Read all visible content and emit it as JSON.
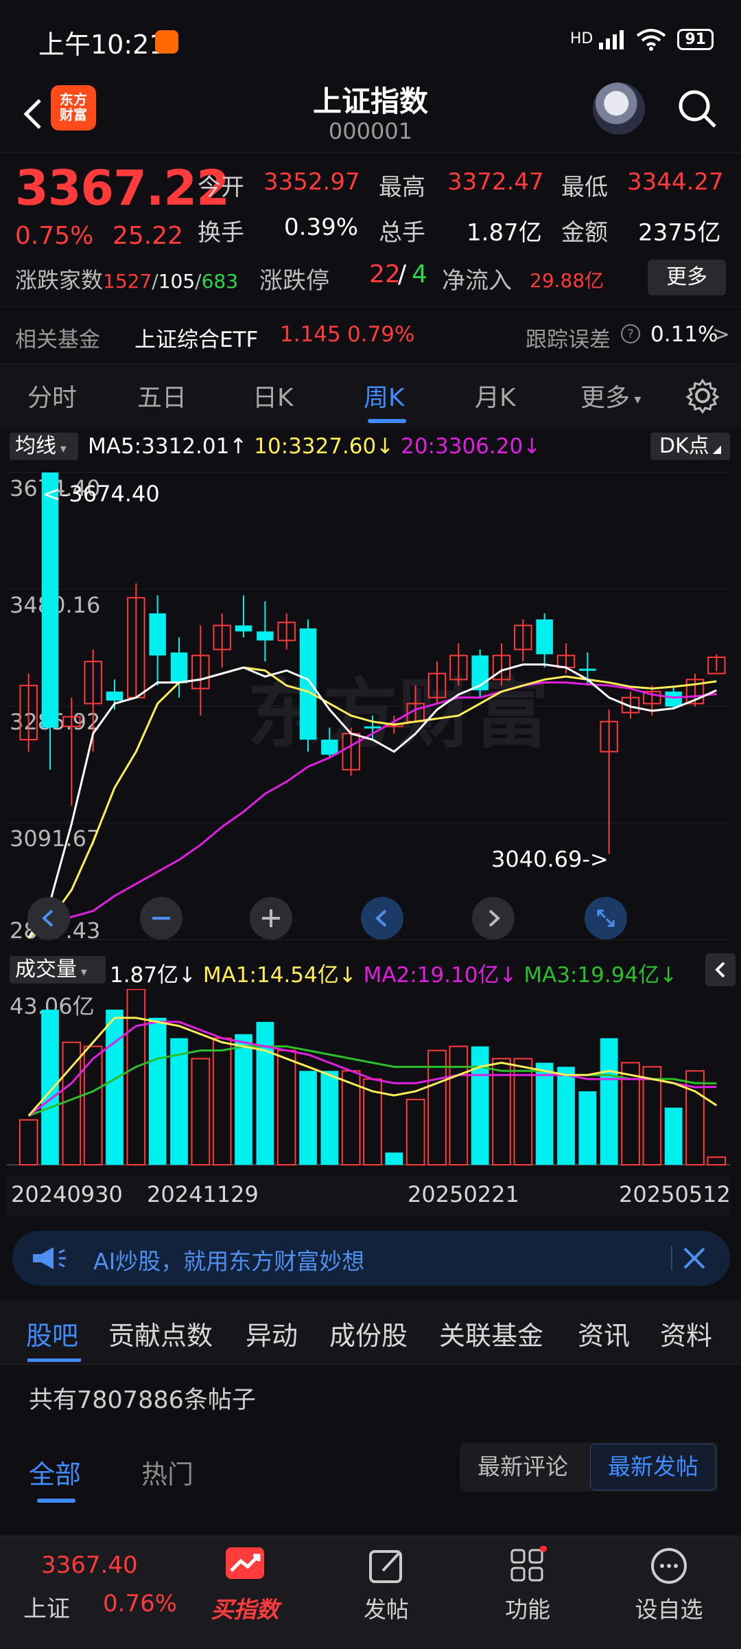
{
  "status_bar": {
    "time": "上午10:21",
    "battery": "91",
    "network": "HD"
  },
  "header": {
    "title": "上证指数",
    "code": "000001",
    "logo_line1": "东方",
    "logo_line2": "财富"
  },
  "quote": {
    "price": "3367.22",
    "change_pct": "0.75%",
    "change_amt": "25.22",
    "open_label": "今开",
    "open": "3352.97",
    "high_label": "最高",
    "high": "3372.47",
    "low_label": "最低",
    "low": "3344.27",
    "turnover_label": "换手",
    "turnover": "0.39%",
    "volume_label": "总手",
    "volume": "1.87亿",
    "amount_label": "金额",
    "amount": "2375亿",
    "adv_label": "涨跌家数",
    "adv_up": "1527",
    "adv_flat": "105",
    "adv_down": "683",
    "limit_label": "涨跌停",
    "limit_up": "22",
    "limit_down": "4",
    "netflow_label": "净流入",
    "netflow": "29.88亿",
    "more_label": "更多"
  },
  "fund": {
    "label": "相关基金",
    "name": "上证综合ETF",
    "price": "1.145",
    "pct": "0.79%",
    "track_label": "跟踪误差",
    "track_value": "0.11%"
  },
  "period_tabs": [
    "分时",
    "五日",
    "日K",
    "周K",
    "月K",
    "更多"
  ],
  "ma_legend": {
    "chip": "均线",
    "ma5": "MA5:3312.01",
    "ma10": "10:3327.60",
    "ma20": "20:3306.20",
    "dk_chip": "DK点"
  },
  "vol_legend": {
    "chip": "成交量",
    "vol": "1.87亿",
    "ma1": "MA1:14.54亿",
    "ma2": "MA2:19.10亿",
    "ma3": "MA3:19.94亿"
  },
  "colors": {
    "up": "#ff3b3b",
    "down": "#00f0f0",
    "ma5": "#ffffff",
    "ma10": "#ffee55",
    "ma20": "#e020e0",
    "vol_ma3": "#2bbf2b",
    "accent": "#3f8cff"
  },
  "chart_data": [
    {
      "type": "candlestick",
      "y_ticks": [
        "3674.40",
        "3480.16",
        "3285.92",
        "3091.67",
        "2897.43"
      ],
      "ylim": [
        2897.43,
        3674.4
      ],
      "annotations": {
        "high": "<-3674.40",
        "low": "3040.69->"
      },
      "candles": [
        {
          "o": 3230,
          "c": 3320,
          "h": 3340,
          "l": 3210
        },
        {
          "o": 3690,
          "c": 3250,
          "h": 3700,
          "l": 3180
        },
        {
          "o": 3252,
          "c": 3268,
          "h": 3300,
          "l": 3120
        },
        {
          "o": 3290,
          "c": 3360,
          "h": 3380,
          "l": 3210
        },
        {
          "o": 3310,
          "c": 3295,
          "h": 3330,
          "l": 3280
        },
        {
          "o": 3300,
          "c": 3466,
          "h": 3490,
          "l": 3300
        },
        {
          "o": 3440,
          "c": 3370,
          "h": 3470,
          "l": 3320
        },
        {
          "o": 3375,
          "c": 3324,
          "h": 3400,
          "l": 3300
        },
        {
          "o": 3315,
          "c": 3370,
          "h": 3420,
          "l": 3270
        },
        {
          "o": 3380,
          "c": 3420,
          "h": 3440,
          "l": 3350
        },
        {
          "o": 3420,
          "c": 3410,
          "h": 3470,
          "l": 3400
        },
        {
          "o": 3410,
          "c": 3395,
          "h": 3460,
          "l": 3360
        },
        {
          "o": 3395,
          "c": 3425,
          "h": 3440,
          "l": 3380
        },
        {
          "o": 3415,
          "c": 3230,
          "h": 3430,
          "l": 3210
        },
        {
          "o": 3230,
          "c": 3205,
          "h": 3250,
          "l": 3200
        },
        {
          "o": 3180,
          "c": 3240,
          "h": 3250,
          "l": 3170
        },
        {
          "o": 3252,
          "c": 3250,
          "h": 3270,
          "l": 3230
        },
        {
          "o": 3252,
          "c": 3256,
          "h": 3270,
          "l": 3240
        },
        {
          "o": 3260,
          "c": 3290,
          "h": 3320,
          "l": 3260
        },
        {
          "o": 3300,
          "c": 3340,
          "h": 3360,
          "l": 3290
        },
        {
          "o": 3330,
          "c": 3370,
          "h": 3390,
          "l": 3320
        },
        {
          "o": 3370,
          "c": 3312,
          "h": 3380,
          "l": 3300
        },
        {
          "o": 3330,
          "c": 3370,
          "h": 3390,
          "l": 3320
        },
        {
          "o": 3380,
          "c": 3420,
          "h": 3430,
          "l": 3360
        },
        {
          "o": 3430,
          "c": 3372,
          "h": 3440,
          "l": 3350
        },
        {
          "o": 3350,
          "c": 3370,
          "h": 3390,
          "l": 3340
        },
        {
          "o": 3348,
          "c": 3345,
          "h": 3375,
          "l": 3320
        },
        {
          "o": 3210,
          "c": 3260,
          "h": 3280,
          "l": 3040
        },
        {
          "o": 3275,
          "c": 3300,
          "h": 3310,
          "l": 3265
        },
        {
          "o": 3290,
          "c": 3310,
          "h": 3320,
          "l": 3270
        },
        {
          "o": 3310,
          "c": 3285,
          "h": 3320,
          "l": 3280
        },
        {
          "o": 3290,
          "c": 3330,
          "h": 3340,
          "l": 3285
        },
        {
          "o": 3340,
          "c": 3367,
          "h": 3372,
          "l": 3344
        }
      ],
      "ma5": [
        2900,
        2960,
        3090,
        3240,
        3290,
        3300,
        3325,
        3325,
        3330,
        3340,
        3350,
        3335,
        3345,
        3330,
        3280,
        3240,
        3230,
        3210,
        3240,
        3280,
        3305,
        3320,
        3345,
        3355,
        3355,
        3350,
        3330,
        3300,
        3285,
        3278,
        3282,
        3296,
        3312
      ],
      "ma10": [
        2900,
        2930,
        2980,
        3060,
        3150,
        3210,
        3290,
        3325,
        3330,
        3340,
        3350,
        3345,
        3320,
        3310,
        3290,
        3270,
        3260,
        3255,
        3260,
        3265,
        3270,
        3290,
        3310,
        3320,
        3330,
        3335,
        3330,
        3325,
        3318,
        3315,
        3318,
        3322,
        3327
      ],
      "ma20": [
        2920,
        2925,
        2935,
        2945,
        2970,
        2990,
        3010,
        3030,
        3055,
        3085,
        3110,
        3140,
        3160,
        3185,
        3200,
        3220,
        3240,
        3260,
        3280,
        3290,
        3300,
        3300,
        3310,
        3320,
        3325,
        3325,
        3322,
        3320,
        3315,
        3305,
        3300,
        3302,
        3306
      ]
    },
    {
      "type": "bar",
      "title": "成交量",
      "y_ticks": [
        "43.06亿"
      ],
      "x_ticks": [
        "20240930",
        "20241129",
        "20250221",
        "20250512"
      ],
      "ylim": [
        0,
        43.06
      ],
      "values": [
        11,
        38,
        30,
        29,
        38,
        43,
        36,
        31,
        26,
        31,
        32,
        35,
        28,
        23,
        23,
        23,
        21,
        3,
        16,
        28,
        29,
        29,
        26,
        26,
        25,
        24,
        18,
        31,
        25,
        24,
        14,
        23,
        1.87
      ],
      "up_down": [
        "u",
        "d",
        "u",
        "u",
        "d",
        "u",
        "d",
        "d",
        "u",
        "u",
        "d",
        "d",
        "u",
        "d",
        "d",
        "u",
        "u",
        "d",
        "u",
        "u",
        "u",
        "d",
        "u",
        "u",
        "d",
        "d",
        "d",
        "d",
        "u",
        "u",
        "d",
        "u",
        "u"
      ],
      "ma1": [
        12,
        18,
        24,
        30,
        36,
        36,
        35,
        34,
        32,
        30,
        29,
        28,
        26,
        24,
        22,
        20,
        18,
        17,
        18,
        20,
        22,
        24,
        25,
        24,
        23,
        22,
        22,
        23,
        22,
        21,
        20,
        18,
        14.54
      ],
      "ma2": [
        12,
        16,
        20,
        26,
        30,
        34,
        35,
        35,
        33,
        31,
        30,
        29,
        28,
        27,
        25,
        23,
        21,
        20,
        20,
        21,
        22,
        22,
        22,
        22,
        22,
        22,
        21,
        21,
        21,
        21,
        20,
        19,
        19.1
      ],
      "ma3": [
        12,
        14,
        16,
        18,
        21,
        24,
        26,
        27,
        28,
        28,
        29,
        29,
        29,
        28,
        27,
        26,
        25,
        24,
        24,
        24,
        24,
        24,
        23,
        23,
        23,
        22,
        22,
        22,
        21,
        21,
        21,
        20,
        19.94
      ]
    }
  ],
  "chart_watermark": "东方财富",
  "ai_banner": {
    "text": "AI炒股，就用东方财富妙想"
  },
  "section_tabs": [
    "股吧",
    "贡献点数",
    "异动",
    "成份股",
    "关联基金",
    "资讯",
    "资料"
  ],
  "posts": {
    "count_text": "共有7807886条帖子"
  },
  "filters": {
    "all": "全部",
    "hot": "热门",
    "latest_comment": "最新评论",
    "latest_post": "最新发帖"
  },
  "bottom_nav": {
    "ticker_price": "3367.40",
    "ticker_name": "上证",
    "ticker_pct": "0.76%",
    "buy_index": "买指数",
    "post": "发帖",
    "function": "功能",
    "watchlist": "设自选"
  }
}
